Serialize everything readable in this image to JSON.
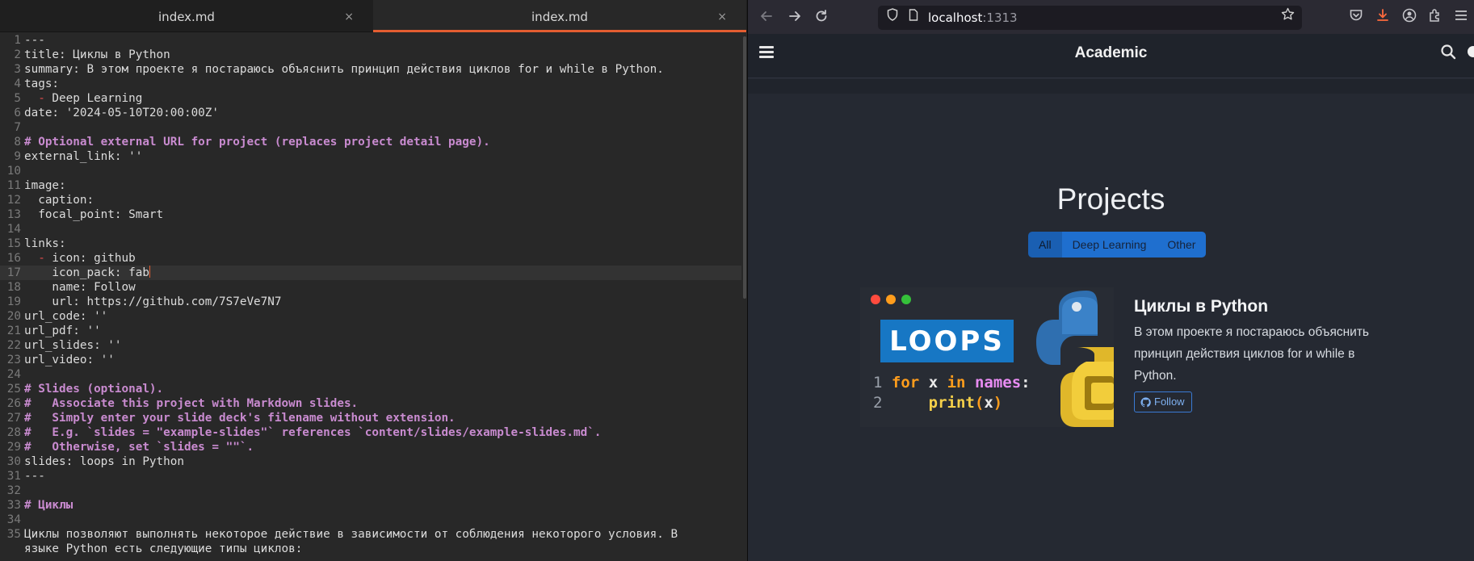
{
  "editor": {
    "tabs": [
      {
        "label": "index.md",
        "close": "×"
      },
      {
        "label": "index.md",
        "close": "×"
      }
    ],
    "lines": [
      {
        "n": "1",
        "t": "---"
      },
      {
        "n": "2",
        "t": "title: Циклы в Python"
      },
      {
        "n": "3",
        "t": "summary: В этом проекте я постараюсь объяснить принцип действия циклов for и while в Python."
      },
      {
        "n": "4",
        "t": "tags:"
      },
      {
        "n": "5",
        "t": "  - Deep Learning"
      },
      {
        "n": "6",
        "t": "date: '2024-05-10T20:00:00Z'"
      },
      {
        "n": "7",
        "t": ""
      },
      {
        "n": "8",
        "t": "# Optional external URL for project (replaces project detail page)."
      },
      {
        "n": "9",
        "t": "external_link: ''"
      },
      {
        "n": "10",
        "t": ""
      },
      {
        "n": "11",
        "t": "image:"
      },
      {
        "n": "12",
        "t": "  caption:"
      },
      {
        "n": "13",
        "t": "  focal_point: Smart"
      },
      {
        "n": "14",
        "t": ""
      },
      {
        "n": "15",
        "t": "links:"
      },
      {
        "n": "16",
        "t": "  - icon: github"
      },
      {
        "n": "17",
        "t": "    icon_pack: fab"
      },
      {
        "n": "18",
        "t": "    name: Follow"
      },
      {
        "n": "19",
        "t": "    url: https://github.com/7S7eVe7N7"
      },
      {
        "n": "20",
        "t": "url_code: ''"
      },
      {
        "n": "21",
        "t": "url_pdf: ''"
      },
      {
        "n": "22",
        "t": "url_slides: ''"
      },
      {
        "n": "23",
        "t": "url_video: ''"
      },
      {
        "n": "24",
        "t": ""
      },
      {
        "n": "25",
        "t": "# Slides (optional)."
      },
      {
        "n": "26",
        "t": "#   Associate this project with Markdown slides."
      },
      {
        "n": "27",
        "t": "#   Simply enter your slide deck's filename without extension."
      },
      {
        "n": "28",
        "t": "#   E.g. `slides = \"example-slides\"` references `content/slides/example-slides.md`."
      },
      {
        "n": "29",
        "t": "#   Otherwise, set `slides = \"\"`."
      },
      {
        "n": "30",
        "t": "slides: loops in Python"
      },
      {
        "n": "31",
        "t": "---"
      },
      {
        "n": "32",
        "t": ""
      },
      {
        "n": "33",
        "t": "# Циклы"
      },
      {
        "n": "34",
        "t": ""
      },
      {
        "n": "35",
        "t": "Циклы позволяют выполнять некоторое действие в зависимости от соблюдения некоторого условия. В"
      },
      {
        "n": "",
        "t": "языке Python есть следующие типы циклов:"
      }
    ],
    "current_line": "17"
  },
  "browser": {
    "url_host": "localhost",
    "url_port": ":1313",
    "site_title": "Academic",
    "projects_heading": "Projects",
    "filters": [
      {
        "label": "All",
        "active": true
      },
      {
        "label": "Deep Learning",
        "active": false
      },
      {
        "label": "Other",
        "active": false
      }
    ],
    "project": {
      "title": "Циклы в Python",
      "summary": "В этом проекте я постараюсь объяснить принцип действия циклов for и while в Python.",
      "button_label": "Follow",
      "thumbnail": {
        "banner": "LOOPS",
        "line1_no": "1",
        "line2_no": "2",
        "kw_for": "for",
        "var_x": "x",
        "kw_in": "in",
        "var_names": "names",
        "colon": ":",
        "func_print": "print",
        "paren_open": "(",
        "arg_x": "x",
        "paren_close": ")"
      }
    }
  },
  "colors": {
    "accent_tab": "#e45d31",
    "comment": "#c98bd0",
    "filter_blue": "#1f6fcf",
    "link_blue": "#7eb0f0"
  }
}
